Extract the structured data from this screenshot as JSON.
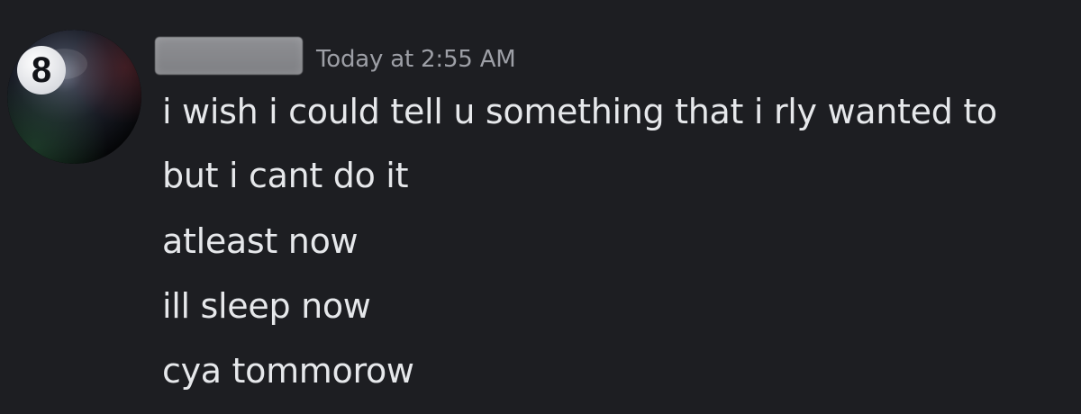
{
  "message": {
    "timestamp": "Today at 2:55 AM",
    "avatar_icon": "eight-ball-icon",
    "avatar_number": "8",
    "lines": [
      "i wish i could tell u something that i rly wanted to",
      "but i cant do it",
      "atleast now",
      "ill sleep now",
      "cya tommorow"
    ]
  },
  "colors": {
    "background": "#1d1e22",
    "message_text": "#e6e8eb",
    "timestamp_text": "#9d9fa6",
    "redacted_name": "#858589"
  }
}
